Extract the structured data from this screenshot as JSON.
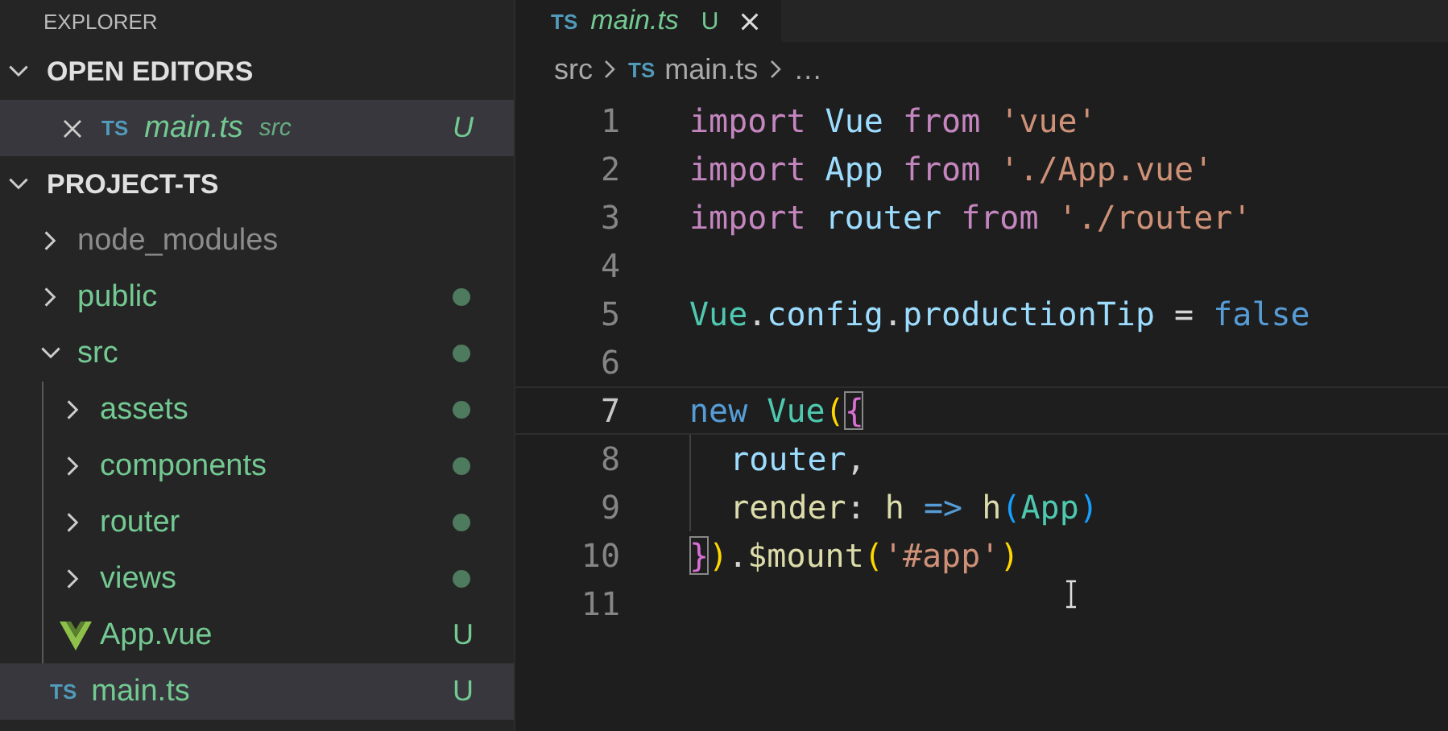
{
  "explorer": {
    "title": "EXPLORER",
    "open_editors": {
      "title": "OPEN EDITORS",
      "expanded": true,
      "items": [
        {
          "name": "main.ts",
          "icon_text": "TS",
          "folder": "src",
          "badge": "U",
          "selected": true
        }
      ]
    },
    "project": {
      "title": "PROJECT-TS",
      "expanded": true,
      "tree": [
        {
          "name": "node_modules",
          "kind": "folder",
          "expanded": false,
          "ignored": true,
          "dot": false
        },
        {
          "name": "public",
          "kind": "folder",
          "expanded": false,
          "ignored": false,
          "dot": true
        },
        {
          "name": "src",
          "kind": "folder",
          "expanded": true,
          "ignored": false,
          "dot": true,
          "children": [
            {
              "name": "assets",
              "kind": "folder",
              "expanded": false,
              "ignored": false,
              "dot": true
            },
            {
              "name": "components",
              "kind": "folder",
              "expanded": false,
              "ignored": false,
              "dot": true
            },
            {
              "name": "router",
              "kind": "folder",
              "expanded": false,
              "ignored": false,
              "dot": true
            },
            {
              "name": "views",
              "kind": "folder",
              "expanded": false,
              "ignored": false,
              "dot": true
            },
            {
              "name": "App.vue",
              "kind": "vue_file",
              "ignored": false,
              "badge": "U",
              "selected": false
            },
            {
              "name": "main.ts",
              "kind": "ts_file",
              "icon_text": "TS",
              "ignored": false,
              "badge": "U",
              "selected": true
            }
          ]
        }
      ]
    }
  },
  "editor": {
    "tabs": [
      {
        "label": "main.ts",
        "icon_text": "TS",
        "badge": "U",
        "selected": true
      }
    ],
    "breadcrumbs": [
      {
        "label": "src"
      },
      {
        "label": "main.ts",
        "icon_text": "TS"
      },
      {
        "label": "…"
      }
    ],
    "lines": [
      {
        "number": "1",
        "current": false,
        "indented": false,
        "tokens": [
          {
            "text": "import ",
            "kind": "keyword"
          },
          {
            "text": "Vue ",
            "kind": "var"
          },
          {
            "text": "from ",
            "kind": "keyword"
          },
          {
            "text": "'vue'",
            "kind": "string"
          }
        ]
      },
      {
        "number": "2",
        "current": false,
        "indented": false,
        "tokens": [
          {
            "text": "import ",
            "kind": "keyword"
          },
          {
            "text": "App ",
            "kind": "var"
          },
          {
            "text": "from ",
            "kind": "keyword"
          },
          {
            "text": "'./App.vue'",
            "kind": "string"
          }
        ]
      },
      {
        "number": "3",
        "current": false,
        "indented": false,
        "tokens": [
          {
            "text": "import ",
            "kind": "keyword"
          },
          {
            "text": "router ",
            "kind": "var"
          },
          {
            "text": "from ",
            "kind": "keyword"
          },
          {
            "text": "'./router'",
            "kind": "string"
          }
        ]
      },
      {
        "number": "4",
        "current": false,
        "indented": false
      },
      {
        "number": "5",
        "current": false,
        "indented": false,
        "tokens": [
          {
            "text": "Vue",
            "kind": "class"
          },
          {
            "text": ".",
            "kind": "plain"
          },
          {
            "text": "config",
            "kind": "var"
          },
          {
            "text": ".",
            "kind": "plain"
          },
          {
            "text": "productionTip",
            "kind": "var"
          },
          {
            "text": " = ",
            "kind": "plain"
          },
          {
            "text": "false",
            "kind": "constant"
          }
        ]
      },
      {
        "number": "6",
        "current": false,
        "indented": false
      },
      {
        "number": "7",
        "current": true,
        "indented": false,
        "tokens": [
          {
            "text": "new ",
            "kind": "constant"
          },
          {
            "text": "Vue",
            "kind": "class"
          },
          {
            "text": "(",
            "kind": "bracket"
          },
          {
            "text": "{",
            "kind": "brace",
            "match": true
          }
        ]
      },
      {
        "number": "8",
        "current": false,
        "indented": true,
        "tokens": [
          {
            "text": "router",
            "kind": "var"
          },
          {
            "text": ",",
            "kind": "plain"
          }
        ]
      },
      {
        "number": "9",
        "current": false,
        "indented": true,
        "tokens": [
          {
            "text": "render",
            "kind": "func"
          },
          {
            "text": ": ",
            "kind": "plain"
          },
          {
            "text": "h ",
            "kind": "func"
          },
          {
            "text": "=> ",
            "kind": "constant"
          },
          {
            "text": "h",
            "kind": "func"
          },
          {
            "text": "(",
            "kind": "paren"
          },
          {
            "text": "App",
            "kind": "class"
          },
          {
            "text": ")",
            "kind": "paren"
          }
        ]
      },
      {
        "number": "10",
        "current": false,
        "indented": false,
        "tokens": [
          {
            "text": "}",
            "kind": "brace",
            "match": true
          },
          {
            "text": ")",
            "kind": "bracket"
          },
          {
            "text": ".",
            "kind": "plain"
          },
          {
            "text": "$mount",
            "kind": "func"
          },
          {
            "text": "(",
            "kind": "bracket"
          },
          {
            "text": "'#app'",
            "kind": "string"
          },
          {
            "text": ")",
            "kind": "bracket"
          }
        ]
      },
      {
        "number": "11",
        "current": false,
        "indented": false
      }
    ]
  }
}
